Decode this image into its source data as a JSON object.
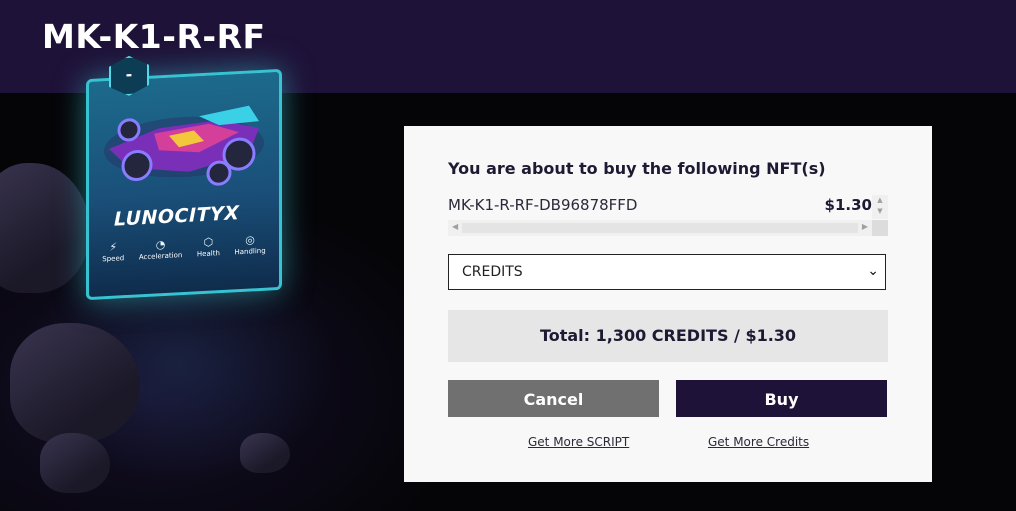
{
  "header": {
    "title": "MK-K1-R-RF"
  },
  "card": {
    "badge": "-",
    "name": "LUNOCITYX",
    "stats": [
      {
        "icon": "lightning-icon",
        "glyph": "⚡",
        "label": "Speed"
      },
      {
        "icon": "gauge-icon",
        "glyph": "◔",
        "label": "Acceleration"
      },
      {
        "icon": "shield-icon",
        "glyph": "⬡",
        "label": "Health"
      },
      {
        "icon": "steering-wheel-icon",
        "glyph": "◎",
        "label": "Handling"
      }
    ]
  },
  "dialog": {
    "heading": "You are about to buy the following NFT(s)",
    "items": [
      {
        "name": "MK-K1-R-RF-DB96878FFD",
        "price": "$1.30"
      }
    ],
    "currency_select": {
      "value": "CREDITS"
    },
    "total": "Total: 1,300 CREDITS / $1.30",
    "cancel_label": "Cancel",
    "buy_label": "Buy",
    "link_script": "Get More SCRIPT",
    "link_credits": "Get More Credits"
  },
  "colors": {
    "header_bg": "#1f1238",
    "buy_button": "#1f1238",
    "cancel_button": "#707070",
    "card_border": "#37c3d1"
  }
}
